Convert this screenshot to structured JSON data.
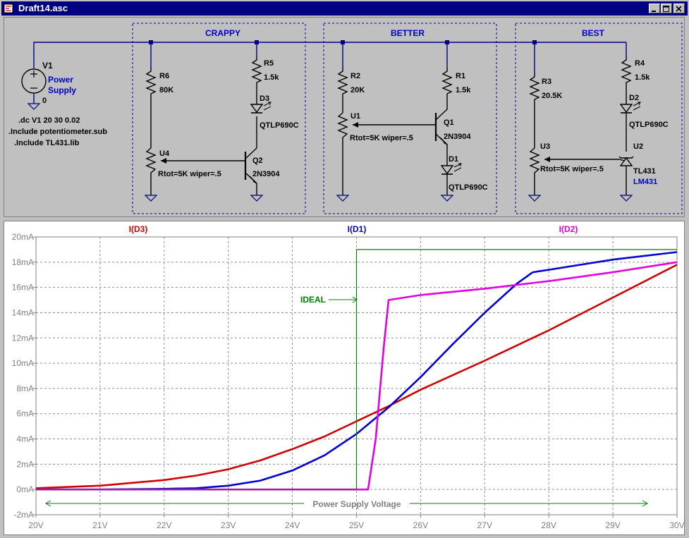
{
  "window": {
    "title": "Draft14.asc",
    "buttons": [
      "minimize",
      "maximize",
      "close"
    ]
  },
  "schematic": {
    "colors": {
      "wire": "#000080",
      "component": "#000000",
      "text_black": "#000000",
      "text_blue": "#0000c8",
      "box": "#0000a0"
    },
    "sections": [
      {
        "label": "CRAPPY"
      },
      {
        "label": "BETTER"
      },
      {
        "label": "BEST"
      }
    ],
    "supply": {
      "name": "V1",
      "value_line1": "Power",
      "value_line2": "Supply",
      "node": "0"
    },
    "directives": [
      ".dc V1 20 30 0.02",
      ".Include potentiometer.sub",
      ".Include TL431.lib"
    ],
    "crappy": {
      "r6_name": "R6",
      "r6_value": "80K",
      "r5_name": "R5",
      "r5_value": "1.5k",
      "d3_name": "D3",
      "d3_value": "QTLP690C",
      "u4_name": "U4",
      "u4_value": "Rtot=5K wiper=.5",
      "q2_name": "Q2",
      "q2_value": "2N3904"
    },
    "better": {
      "r2_name": "R2",
      "r2_value": "20K",
      "r1_name": "R1",
      "r1_value": "1.5k",
      "u1_name": "U1",
      "u1_value": "Rtot=5K wiper=.5",
      "q1_name": "Q1",
      "q1_value": "2N3904",
      "d1_name": "D1",
      "d1_value": "QTLP690C"
    },
    "best": {
      "r3_name": "R3",
      "r3_value": "20.5K",
      "r4_name": "R4",
      "r4_value": "1.5k",
      "d2_name": "D2",
      "d2_value": "QTLP690C",
      "u3_name": "U3",
      "u3_value": "Rtot=5K wiper=.5",
      "u2_name": "U2",
      "u2_value": "TL431",
      "u2_value2": "LM431"
    }
  },
  "chart_data": {
    "type": "line",
    "x_ticks": [
      "20V",
      "21V",
      "22V",
      "23V",
      "24V",
      "25V",
      "26V",
      "27V",
      "28V",
      "29V",
      "30V"
    ],
    "y_ticks": [
      "20mA",
      "18mA",
      "16mA",
      "14mA",
      "12mA",
      "10mA",
      "8mA",
      "6mA",
      "4mA",
      "2mA",
      "0mA",
      "-2mA"
    ],
    "xlim": [
      20,
      30
    ],
    "ylim": [
      -2,
      20
    ],
    "grid": true,
    "series": [
      {
        "name": "I(D3)",
        "color": "#d00000",
        "x": [
          20,
          21,
          22,
          22.5,
          23,
          23.5,
          24,
          24.5,
          25,
          25.5,
          26,
          27,
          28,
          29,
          30
        ],
        "y": [
          0.1,
          0.3,
          0.75,
          1.1,
          1.6,
          2.3,
          3.2,
          4.2,
          5.4,
          6.6,
          7.9,
          10.2,
          12.6,
          15.2,
          17.8
        ]
      },
      {
        "name": "I(D1)",
        "color": "#0000d0",
        "x": [
          20,
          21,
          22,
          22.5,
          23,
          23.5,
          24,
          24.5,
          25,
          25.5,
          26,
          26.5,
          27,
          27.5,
          27.75,
          28,
          28.5,
          29,
          30
        ],
        "y": [
          0,
          0,
          0.05,
          0.1,
          0.3,
          0.7,
          1.5,
          2.7,
          4.4,
          6.5,
          8.9,
          11.5,
          14,
          16.3,
          17.2,
          17.4,
          17.8,
          18.2,
          18.8
        ]
      },
      {
        "name": "I(D2)",
        "color": "#e000e0",
        "x": [
          20,
          21,
          22,
          23,
          24,
          25,
          25.18,
          25.3,
          25.42,
          25.5,
          26,
          27,
          28,
          29,
          30
        ],
        "y": [
          0,
          0,
          0,
          0,
          0,
          0,
          0,
          4,
          11,
          15,
          15.4,
          15.9,
          16.5,
          17.2,
          18
        ]
      },
      {
        "name": "",
        "color": "#008000",
        "x": [
          20,
          25,
          25,
          25.02,
          30
        ],
        "y": [
          0,
          0,
          19,
          19,
          19
        ]
      }
    ],
    "annotations": [
      {
        "text": "IDEAL",
        "color": "#008000"
      },
      {
        "text": "Power Supply Voltage",
        "color": "#008000"
      }
    ]
  }
}
